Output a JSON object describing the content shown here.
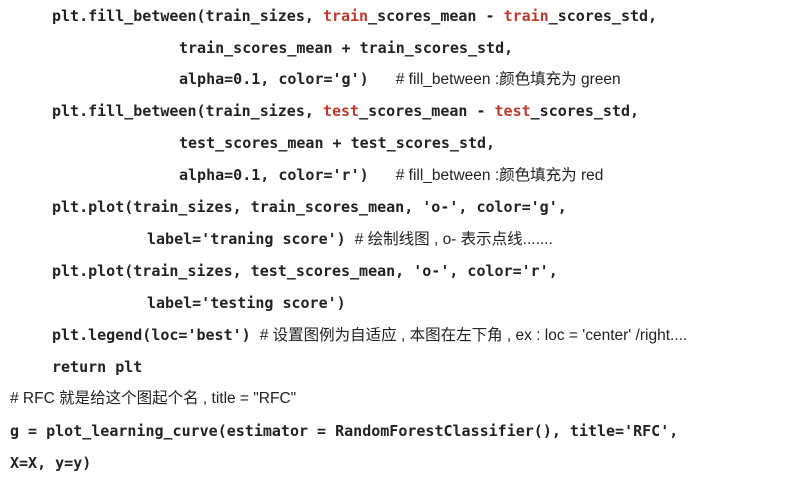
{
  "lines": [
    {
      "parts": [
        "plt.fill_between(train_sizes, ",
        "train",
        "_scores_mean - ",
        "train",
        "_scores_std,"
      ]
    },
    {
      "text": "train_scores_mean + train_scores_std,"
    },
    {
      "code": "alpha=0.1, color='g')",
      "comment": "# fill_between :颜色填充为 green"
    },
    {
      "parts": [
        "plt.fill_between(train_sizes, ",
        "test",
        "_scores_mean - ",
        "test",
        "_scores_std,"
      ]
    },
    {
      "text": "test_scores_mean + test_scores_std,"
    },
    {
      "code": "alpha=0.1, color='r')",
      "comment": "# fill_between :颜色填充为 red"
    },
    {
      "text": "plt.plot(train_sizes, train_scores_mean, 'o-', color='g',"
    },
    {
      "code": "label='traning score')",
      "comment": "# 绘制线图 , o- 表示点线......."
    },
    {
      "text": "plt.plot(train_sizes, test_scores_mean, 'o-', color='r',"
    },
    {
      "text": "label='testing score')"
    },
    {
      "code": "plt.legend(loc='best')",
      "comment": "# 设置图例为自适应 , 本图在左下角 , ex : loc = 'center' /right...."
    },
    {
      "text": "return plt"
    },
    {
      "comment": "# RFC 就是给这个图起个名 , title = \"RFC\""
    },
    {
      "text": "g = plot_learning_curve(estimator = RandomForestClassifier(), title='RFC',"
    },
    {
      "text": "X=X, y=y)"
    }
  ],
  "colors": {
    "text": "#222222",
    "highlight": "#c0392b",
    "background": "#ffffff"
  }
}
